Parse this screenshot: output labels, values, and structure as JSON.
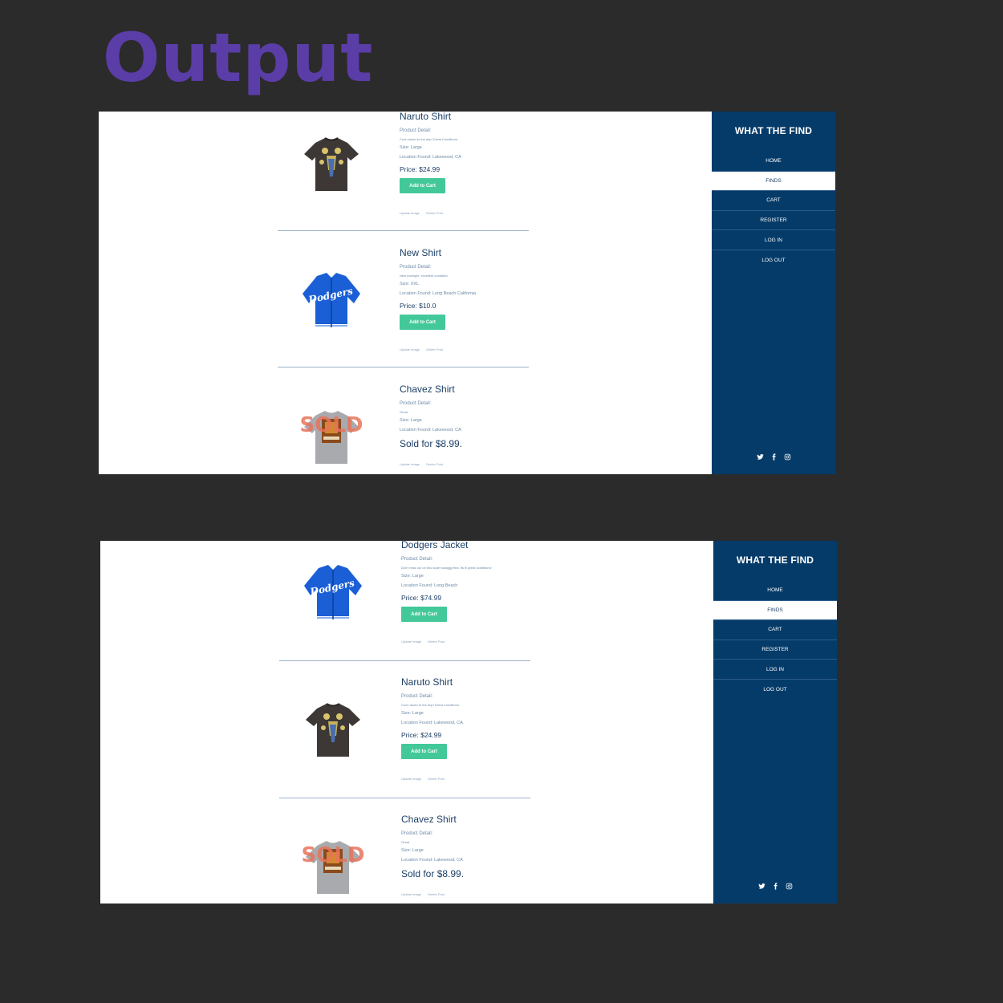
{
  "header": {
    "title": "Output",
    "title_color": "#5b3da8"
  },
  "colors": {
    "sidebar": "#053b69",
    "button": "#43c89a",
    "text_dark": "#1d3f66",
    "text_light": "#6d8aa8",
    "sold_overlay": "#e8735b"
  },
  "sidebar": {
    "brand": "WHAT THE FIND",
    "nav": [
      {
        "label": "HOME"
      },
      {
        "label": "FINDS",
        "active": true
      },
      {
        "label": "CART"
      },
      {
        "label": "REGISTER"
      },
      {
        "label": "LOG IN"
      },
      {
        "label": "LOG OUT"
      }
    ],
    "social_icons": [
      "twitter-icon",
      "facebook-icon",
      "instagram-icon"
    ]
  },
  "screens": [
    {
      "products": [
        {
          "image": "naruto-shirt-image",
          "title": "Naruto Shirt",
          "detail_label": "Product Detail:",
          "description": "Cool naruto fo the drip! Great Conditions.",
          "size": "Size: Large",
          "location": "Location Found: Lakewood, CA",
          "price": "Price: $24.99",
          "button": "Add to Cart",
          "update": "Update Image",
          "delete": "Delete Post"
        },
        {
          "image": "dodgers-jacket-image",
          "title": "New Shirt",
          "detail_label": "Product Detail:",
          "description": "New example, excellent condition!",
          "size": "Size: XXL",
          "location": "Location Found: Long Beach California",
          "price": "Price: $10.0",
          "button": "Add to Cart",
          "update": "Update Image",
          "delete": "Delete Post"
        },
        {
          "image": "chavez-shirt-image",
          "sold_stamp": "SOLD",
          "title": "Chavez Shirt",
          "detail_label": "Product Detail:",
          "description": "Great",
          "size": "Size: Large",
          "location": "Location Found: Lakewood, CA",
          "sold_text": "Sold for $8.99.",
          "update": "Update Image",
          "delete": "Delete Post"
        }
      ]
    },
    {
      "products": [
        {
          "image": "dodgers-jacket-image",
          "title": "Dodgers Jacket",
          "detail_label": "Product Detail:",
          "description": "Don't miss out on this super swaggy find. Its in great conditions!",
          "size": "Size: Large",
          "location": "Location Found: Long Beach",
          "price": "Price: $74.99",
          "button": "Add to Cart",
          "update": "Update Image",
          "delete": "Delete Post"
        },
        {
          "image": "naruto-shirt-image",
          "title": "Naruto Shirt",
          "detail_label": "Product Detail:",
          "description": "Cool naruto fo the drip! Great Conditions.",
          "size": "Size: Large",
          "location": "Location Found: Lakewood, CA",
          "price": "Price: $24.99",
          "button": "Add to Cart",
          "update": "Update Image",
          "delete": "Delete Post"
        },
        {
          "image": "chavez-shirt-image",
          "sold_stamp": "SOLD",
          "title": "Chavez Shirt",
          "detail_label": "Product Detail:",
          "description": "Great",
          "size": "Size: Large",
          "location": "Location Found: Lakewood, CA",
          "sold_text": "Sold for $8.99.",
          "update": "Update Image",
          "delete": "Delete Post"
        }
      ]
    }
  ]
}
